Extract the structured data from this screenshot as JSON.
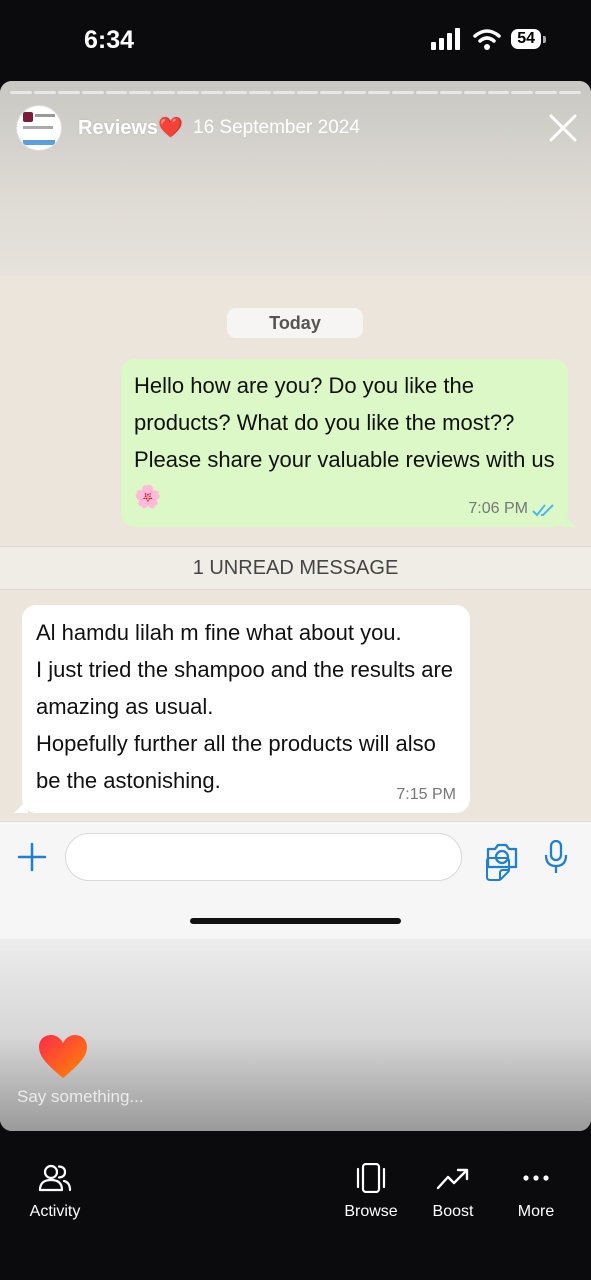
{
  "status_bar": {
    "time": "6:34",
    "battery": "54"
  },
  "story": {
    "account_name": "Reviews❤️",
    "date": "16 September 2024",
    "reply_placeholder": "Say something..."
  },
  "chat": {
    "date_chip": "Today",
    "outgoing": {
      "text": "Hello how are you? Do you like the products? What do you like the most?? Please share your valuable reviews with us 🌸",
      "time": "7:06 PM"
    },
    "unread_label": "1 UNREAD MESSAGE",
    "incoming": {
      "lines": [
        "Al hamdu lilah m fine what about you.",
        "I just tried the shampoo and the results are amazing as usual.",
        "Hopefully further all the products will also be the astonishing."
      ],
      "time": "7:15 PM"
    }
  },
  "tabs": [
    {
      "label": "Activity",
      "icon": "people-icon"
    },
    {
      "label": "Browse",
      "icon": "browse-icon"
    },
    {
      "label": "Boost",
      "icon": "trending-up-icon"
    },
    {
      "label": "More",
      "icon": "more-icon"
    }
  ],
  "colors": {
    "outgoing_bubble": "#dcf8c6",
    "incoming_bubble": "#ffffff",
    "whatsapp_blue": "#1f7fd1",
    "read_tick": "#4fb6ec"
  }
}
